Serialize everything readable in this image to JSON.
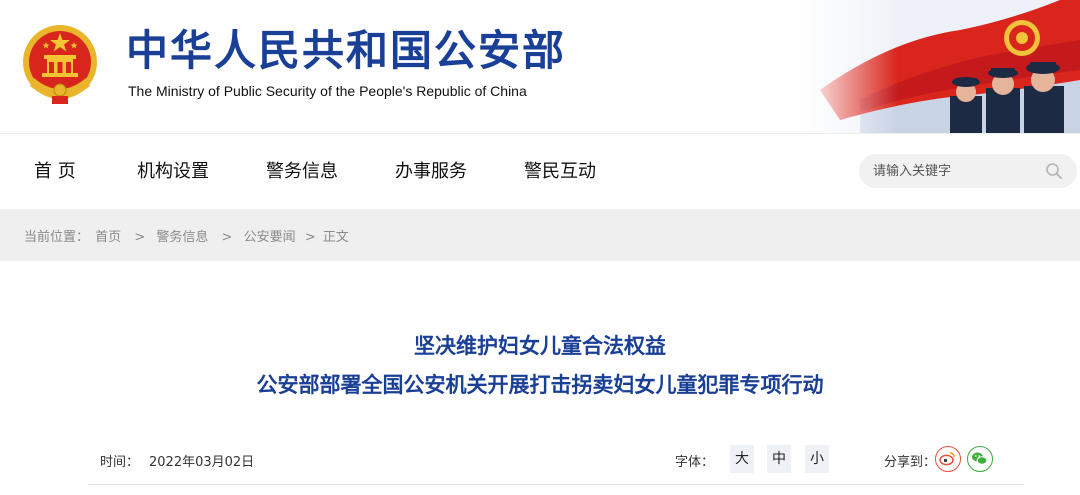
{
  "header": {
    "title_cn": "中华人民共和国公安部",
    "title_en": "The Ministry of Public Security of the People's Republic of China",
    "emblem_icon": "national-emblem-icon",
    "banner_image": "police-honor-guard-flag-banner"
  },
  "nav": {
    "items": [
      {
        "label": "首 页"
      },
      {
        "label": "机构设置"
      },
      {
        "label": "警务信息"
      },
      {
        "label": "办事服务"
      },
      {
        "label": "警民互动"
      }
    ],
    "search": {
      "placeholder": "请输入关键字",
      "icon": "search-icon"
    }
  },
  "breadcrumb": {
    "prefix": "当前位置：",
    "items": [
      "首页",
      "警务信息",
      "公安要闻"
    ],
    "separator": ">",
    "current": "正文"
  },
  "article": {
    "title_line1": "坚决维护妇女儿童合法权益",
    "title_line2": "公安部部署全国公安机关开展打击拐卖妇女儿童犯罪专项行动",
    "time_label": "时间：",
    "time_value": "2022年03月02日",
    "font_label": "字体：",
    "font_sizes": [
      "大",
      "中",
      "小"
    ],
    "share_label": "分享到：",
    "share_targets": [
      "weibo-icon",
      "wechat-icon"
    ]
  },
  "colors": {
    "brand_blue": "#1a3f96",
    "flag_red": "#d9251c",
    "breadcrumb_bg": "#efefef",
    "search_bg": "#f1f1f1"
  }
}
